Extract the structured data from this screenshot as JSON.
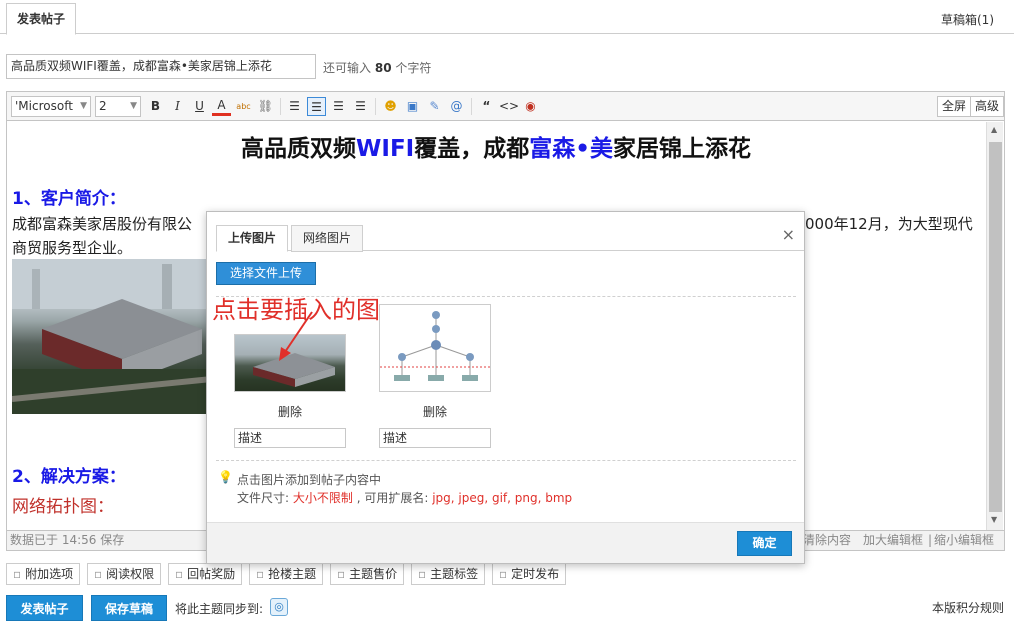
{
  "tabs": {
    "active": "发表帖子",
    "drafts": "草稿箱(1)"
  },
  "title_field": {
    "value": "高品质双频WIFI覆盖，成都富森•美家居锦上添花",
    "hint_prefix": "还可输入",
    "hint_count": "80",
    "hint_suffix": "个字符"
  },
  "toolbar": {
    "font_value": "'Microsoft",
    "size_value": "2",
    "fullscreen_label": "全屏",
    "advanced_label": "高级",
    "icons": [
      "bold-icon",
      "italic-icon",
      "underline-icon",
      "font-color-icon",
      "background-color-icon",
      "link-icon",
      "align-left-icon",
      "align-center-icon",
      "align-justify-icon",
      "align-right-icon",
      "emoticon-icon",
      "image-icon",
      "attachment-icon",
      "mention-icon",
      "quote-icon",
      "code-icon",
      "qq-icon"
    ]
  },
  "content": {
    "title_part1": "高品质双频",
    "title_blue1": "WIFI",
    "title_part2": "覆盖，成都",
    "title_blue2": "富森•美",
    "title_part3": "家居锦上添花",
    "section1_heading": "1、客户简介：",
    "section1_text_a": "成都富森美家居股份有限公",
    "section1_text_b": "000年12月，为大型现代",
    "section1_text_c": "商贸服务型企业。",
    "section2_heading": "2、解决方案：",
    "section2_sub": "网络拓扑图："
  },
  "statusbar": {
    "saved": "数据已于 14:56 保存",
    "clear": "清除内容",
    "enlarge": "加大编辑框",
    "sep": "|",
    "shrink": "缩小编辑框"
  },
  "options": [
    "附加选项",
    "阅读权限",
    "回帖奖励",
    "抢楼主题",
    "主题售价",
    "主题标签",
    "定时发布"
  ],
  "actions": {
    "publish": "发表帖子",
    "save_draft": "保存草稿",
    "sync_label": "将此主题同步到:",
    "rules": "本版积分规则"
  },
  "dialog": {
    "tab_upload": "上传图片",
    "tab_network": "网络图片",
    "close": "×",
    "upload_button": "选择文件上传",
    "annotation": "点击要插入的图",
    "images": [
      {
        "delete": "删除",
        "desc": "描述"
      },
      {
        "delete": "删除",
        "desc": "描述"
      }
    ],
    "tip1": "点击图片添加到帖子内容中",
    "tip2_prefix": "文件尺寸: ",
    "tip2_size": "大小不限制",
    "tip2_mid": " , 可用扩展名: ",
    "tip2_ext": "jpg, jpeg, gif, png, bmp",
    "ok": "确定"
  },
  "colors": {
    "accent": "#1e8ed6",
    "link_blue": "#1a1ae6",
    "annotation_red": "#e0302a"
  }
}
